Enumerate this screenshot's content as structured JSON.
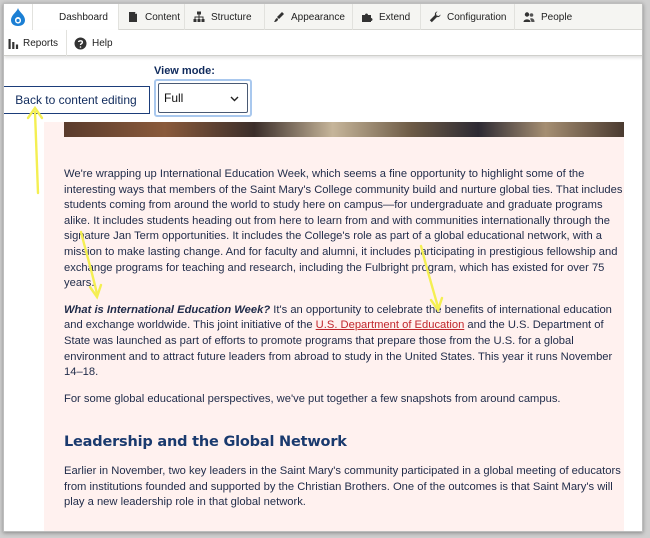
{
  "toolbar": {
    "logo_icon": "drupal-drop-icon",
    "tabs": [
      {
        "label": "Dashboard",
        "icon": "none"
      },
      {
        "label": "Content",
        "icon": "document-icon"
      },
      {
        "label": "Structure",
        "icon": "sitemap-icon"
      },
      {
        "label": "Appearance",
        "icon": "paint-brush-icon"
      },
      {
        "label": "Extend",
        "icon": "puzzle-icon"
      },
      {
        "label": "Configuration",
        "icon": "wrench-icon"
      },
      {
        "label": "People",
        "icon": "people-icon"
      }
    ],
    "secondary": [
      {
        "label": "Reports",
        "icon": "bar-chart-icon"
      },
      {
        "label": "Help",
        "icon": "help-icon"
      }
    ]
  },
  "view_mode": {
    "back_label": "Back to content editing",
    "label": "View mode:",
    "selected": "Full"
  },
  "article": {
    "p1": "We're wrapping up International Education Week, which seems a fine opportunity to highlight some of the interesting ways that members of the Saint Mary's College community build and nurture global ties. That includes students coming from around the world to study here on campus—for undergraduate and graduate programs alike. It includes students heading out from here to learn from and with communities internationally through the signature Jan Term opportunities. It includes the College's role as part of a global educational network, with a mission to make lasting change. And for faculty and alumni, it includes participating in prestigious fellowship and exchange programs for teaching and research, including the Fulbright program, which has existed for over 75 years.",
    "p2_lead": "What is International Education Week?",
    "p2_a": " It's an opportunity to celebrate the benefits of international education and exchange worldwide. This joint initiative of the ",
    "p2_link": "U.S. Department of Education",
    "p2_b": " and the U.S. Department of State was launched as part of efforts to promote programs that prepare those from the U.S. for a global environment and to attract future leaders from abroad to study in the United States. This year it runs November 14–18.",
    "p3": "For some global educational perspectives, we've put together a few snapshots from around campus.",
    "h2": "Leadership and the Global Network",
    "p4": "Earlier in November, two key leaders in the Saint Mary's community participated in a global meeting of educators from institutions founded and supported by the Christian Brothers. One of the outcomes is that Saint Mary's will play a new leadership role in that global network."
  },
  "colors": {
    "article_bg": "#fff1ef",
    "heading": "#1a3a6e",
    "text": "#1f2b49",
    "link": "#c0262c",
    "annotation_arrow": "#f4ef52"
  }
}
